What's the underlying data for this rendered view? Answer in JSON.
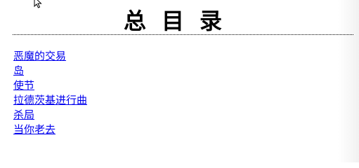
{
  "title": "总目录",
  "toc": {
    "items": [
      {
        "label": "恶魔的交易"
      },
      {
        "label": "岛"
      },
      {
        "label": "使节"
      },
      {
        "label": "拉德茨基进行曲"
      },
      {
        "label": "杀局"
      },
      {
        "label": "当你老去"
      }
    ]
  },
  "colors": {
    "link": "#0000ee",
    "text": "#000000",
    "background": "#ffffff"
  },
  "icons": {
    "cursor": "mouse-pointer-icon"
  }
}
